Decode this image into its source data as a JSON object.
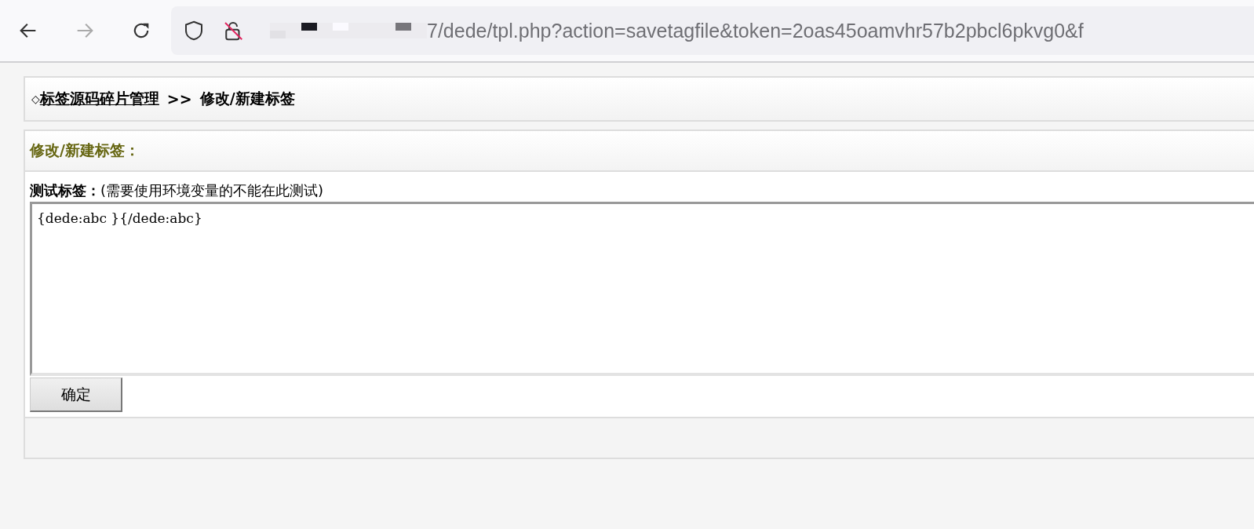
{
  "browser": {
    "url": "7/dede/tpl.php?action=savetagfile&token=2oas45oamvhr57b2pbcl6pkvg0&f",
    "forward_disabled": true
  },
  "breadcrumb": {
    "marker": "◇",
    "link": "标签源码碎片管理",
    "separator": ">>",
    "current": "修改/新建标签"
  },
  "panel": {
    "title": "修改/新建标签：",
    "label": "测试标签：",
    "hint": "(需要使用环境变量的不能在此测试)",
    "code": "{dede:abc }{/dede:abc}",
    "button": "确定"
  }
}
